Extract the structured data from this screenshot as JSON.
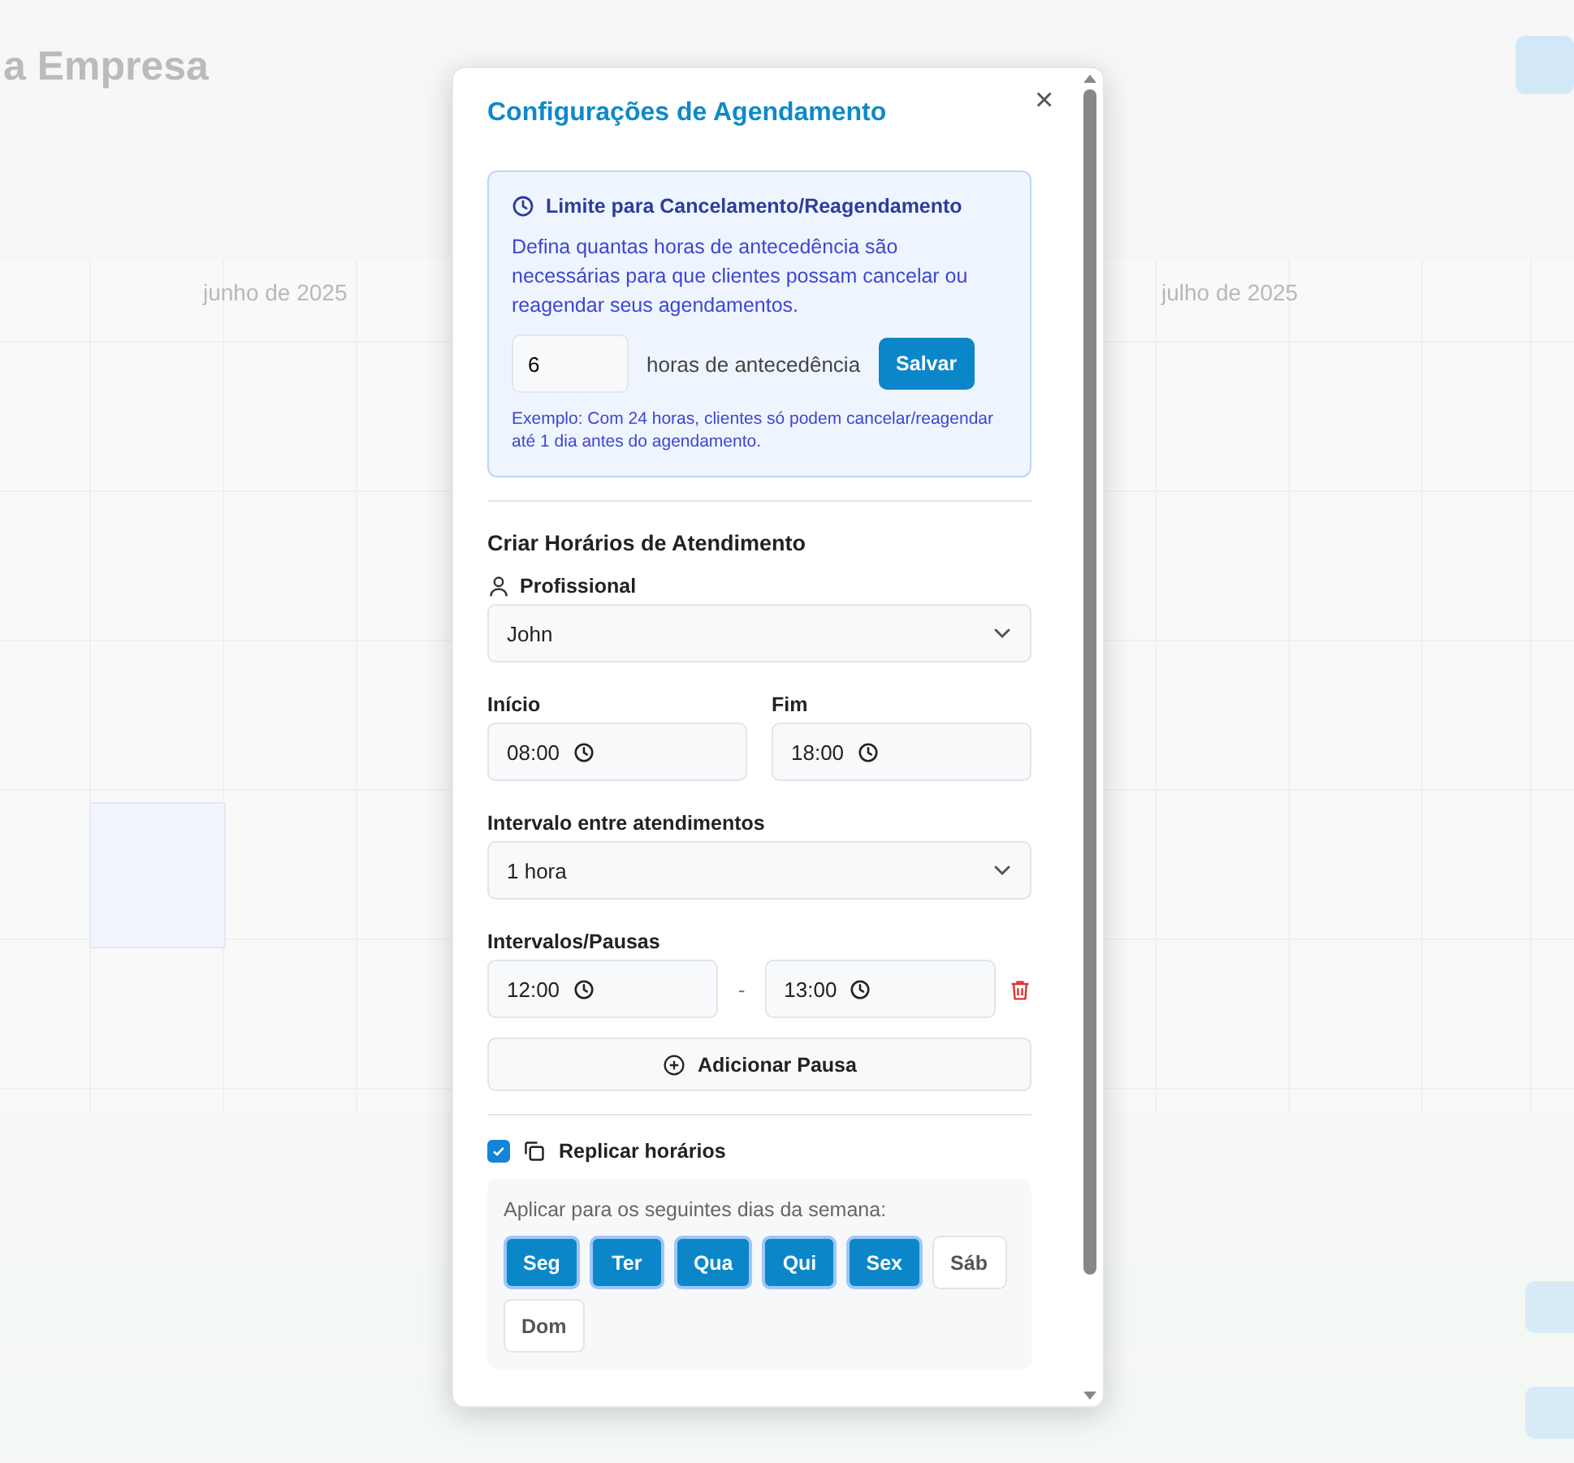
{
  "background": {
    "title": "a Empresa",
    "months": [
      {
        "label": "junho de 2025"
      },
      {
        "label": "julho de 2025"
      }
    ]
  },
  "dialog": {
    "title": "Configurações de Agendamento",
    "close": "×",
    "limit": {
      "title": "Limite para Cancelamento/Reagendamento",
      "description": "Defina quantas horas de antecedência são necessárias para que clientes possam cancelar ou reagendar seus agendamentos.",
      "hours_value": "6",
      "hours_label": "horas de antecedência",
      "save": "Salvar",
      "example": "Exemplo: Com 24 horas, clientes só podem cancelar/reagendar até 1 dia antes do agendamento."
    },
    "schedule": {
      "title": "Criar Horários de Atendimento",
      "professional": {
        "label": "Profissional",
        "value": "John"
      },
      "start": {
        "label": "Início",
        "value": "08:00"
      },
      "end": {
        "label": "Fim",
        "value": "18:00"
      },
      "interval": {
        "label": "Intervalo entre atendimentos",
        "value": "1 hora"
      },
      "breaks": {
        "label": "Intervalos/Pausas",
        "separator": "-",
        "items": [
          {
            "start": "12:00",
            "end": "13:00"
          }
        ],
        "add": "Adicionar Pausa"
      },
      "replicate": {
        "label": "Replicar horários",
        "checked": true
      },
      "days_prompt": "Aplicar para os seguintes dias da semana:",
      "days": [
        {
          "label": "Seg",
          "selected": true
        },
        {
          "label": "Ter",
          "selected": true
        },
        {
          "label": "Qua",
          "selected": true
        },
        {
          "label": "Qui",
          "selected": true
        },
        {
          "label": "Sex",
          "selected": true
        },
        {
          "label": "Sáb",
          "selected": false
        },
        {
          "label": "Dom",
          "selected": false
        }
      ]
    }
  }
}
